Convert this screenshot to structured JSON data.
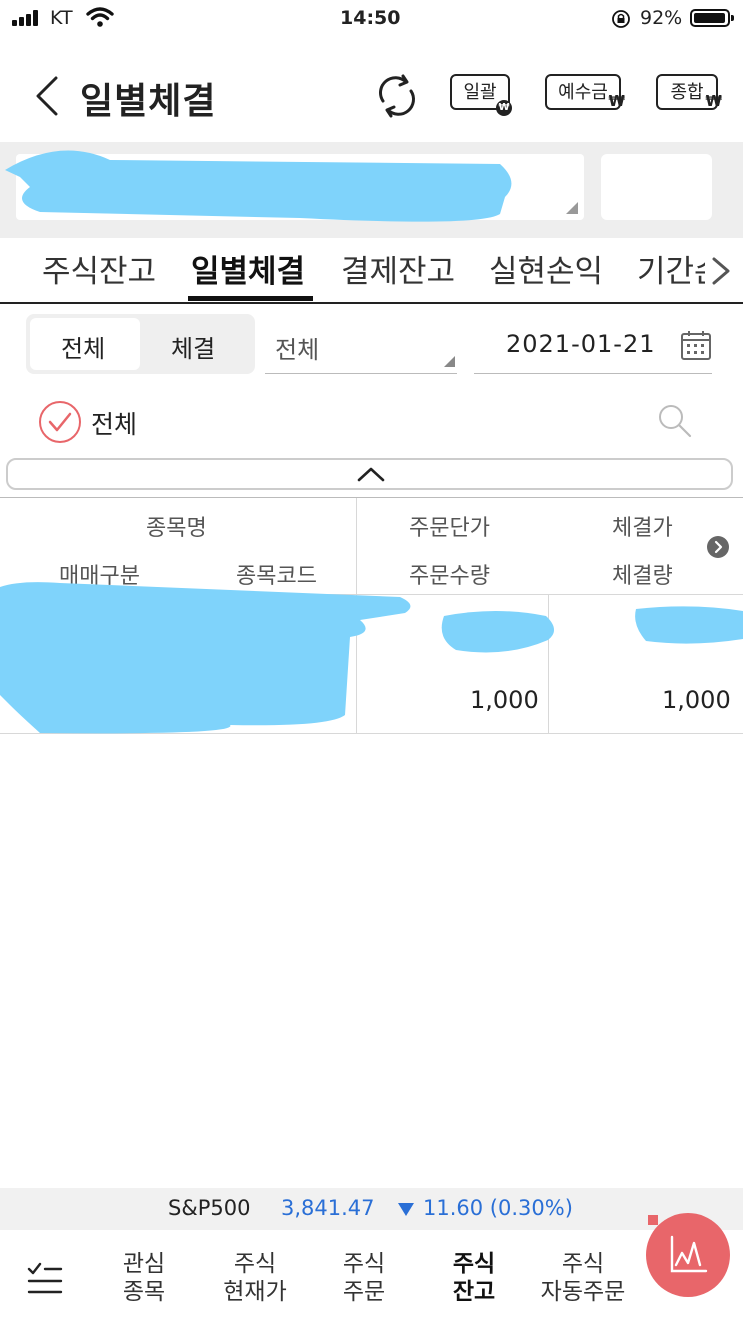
{
  "status_bar": {
    "carrier": "KT",
    "time": "14:50",
    "battery": "92%"
  },
  "header": {
    "title": "일별체결",
    "buttons": [
      {
        "label": "일괄",
        "suffix": "₩"
      },
      {
        "label": "예수금",
        "suffix": "₩"
      },
      {
        "label": "종합",
        "suffix": "₩"
      }
    ]
  },
  "tabs": [
    "주식잔고",
    "일별체결",
    "결제잔고",
    "실현손익",
    "기간손"
  ],
  "active_tab": "일별체결",
  "filters": {
    "segment": [
      "전체",
      "체결"
    ],
    "segment_selected": "전체",
    "dropdown_value": "전체",
    "date": "2021-01-21",
    "checkbox_label": "전체"
  },
  "table": {
    "headers": {
      "col1_top": "종목명",
      "col1_left": "매매구분",
      "col1_right": "종목코드",
      "col2_top": "주문단가",
      "col2_bottom": "주문수량",
      "col3_top": "체결가",
      "col3_bottom": "체결량"
    },
    "rows": [
      {
        "order_qty": "1,000",
        "exec_qty": "1,000"
      }
    ]
  },
  "ticker": {
    "index_name": "S&P500",
    "value": "3,841.47",
    "change": "11.60 (0.30%)",
    "down_color": "#2a6fd6"
  },
  "bottom_nav": [
    {
      "line1": "관심",
      "line2": "종목"
    },
    {
      "line1": "주식",
      "line2": "현재가"
    },
    {
      "line1": "주식",
      "line2": "주문"
    },
    {
      "line1": "주식",
      "line2": "잔고"
    },
    {
      "line1": "주식",
      "line2": "자동주문"
    }
  ],
  "colors": {
    "accent_red": "#e8666a",
    "redaction": "#7fd3fb"
  }
}
